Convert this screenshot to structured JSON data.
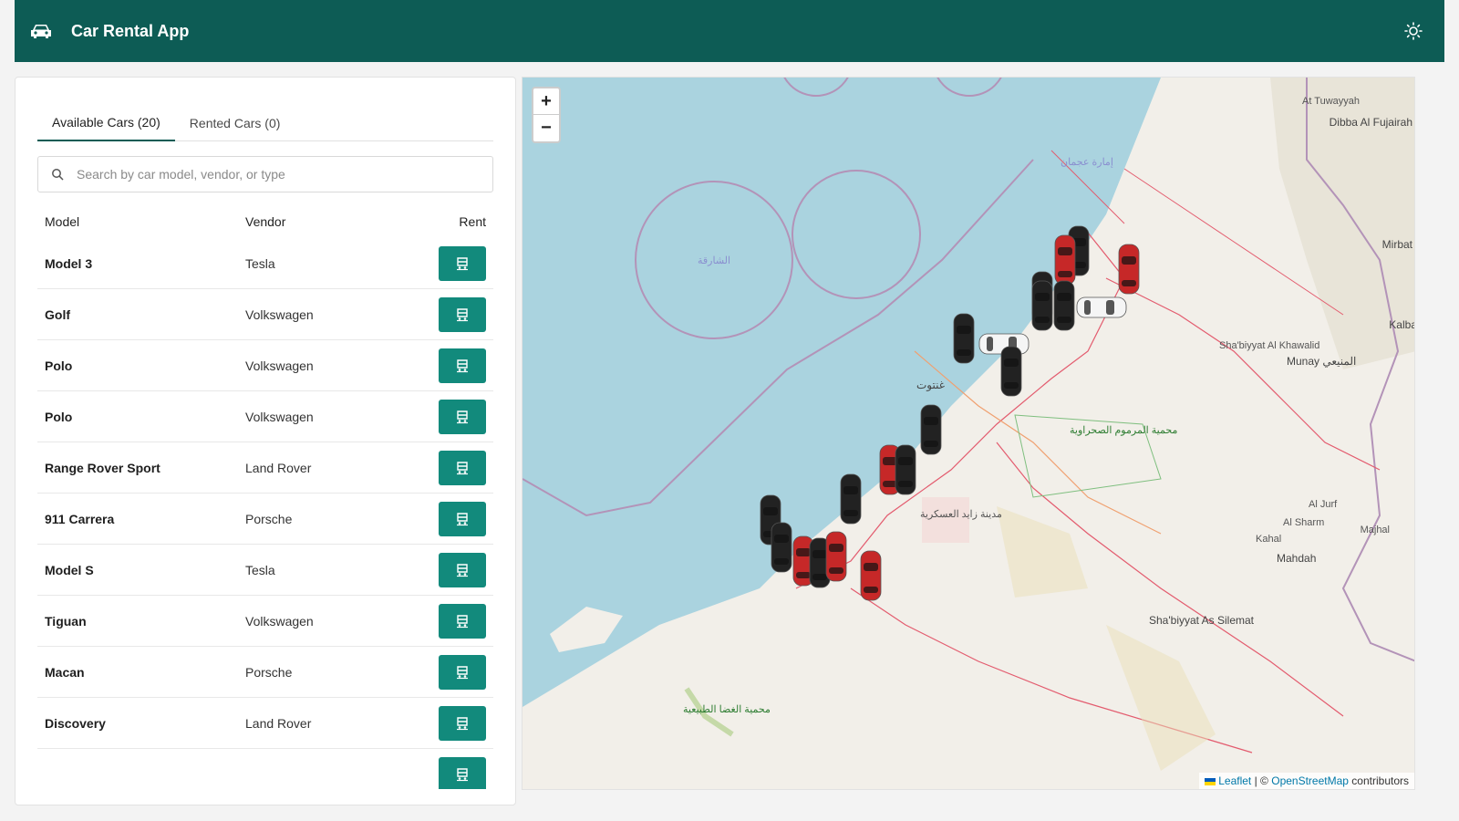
{
  "app": {
    "title": "Car Rental App",
    "accent": "#0d5c55",
    "button_color": "#128a7c"
  },
  "tabs": [
    {
      "label": "Available Cars (20)",
      "active": true
    },
    {
      "label": "Rented Cars (0)",
      "active": false
    }
  ],
  "search": {
    "placeholder": "Search by car model, vendor, or type",
    "value": ""
  },
  "table": {
    "headers": {
      "model": "Model",
      "vendor": "Vendor",
      "rent": "Rent"
    },
    "rows": [
      {
        "model": "Model 3",
        "vendor": "Tesla"
      },
      {
        "model": "Golf",
        "vendor": "Volkswagen"
      },
      {
        "model": "Polo",
        "vendor": "Volkswagen"
      },
      {
        "model": "Polo",
        "vendor": "Volkswagen"
      },
      {
        "model": "Range Rover Sport",
        "vendor": "Land Rover"
      },
      {
        "model": "911 Carrera",
        "vendor": "Porsche"
      },
      {
        "model": "Model S",
        "vendor": "Tesla"
      },
      {
        "model": "Tiguan",
        "vendor": "Volkswagen"
      },
      {
        "model": "Macan",
        "vendor": "Porsche"
      },
      {
        "model": "Discovery",
        "vendor": "Land Rover"
      },
      {
        "model": "",
        "vendor": ""
      }
    ]
  },
  "map": {
    "zoom_in": "+",
    "zoom_out": "−",
    "attribution": {
      "leaflet": "Leaflet",
      "sep": "| ©",
      "osm": "OpenStreetMap",
      "suffix": "contributors"
    },
    "labels": [
      {
        "text": "الشارقة",
        "cls": "blue"
      },
      {
        "text": "Sha'biyyat As Silemat",
        "cls": "big"
      },
      {
        "text": "Mahdah",
        "cls": "big"
      },
      {
        "text": "Munay المنيعي",
        "cls": "big"
      },
      {
        "text": "Dibba Al Fujairah",
        "cls": "big"
      },
      {
        "text": "Kalba",
        "cls": "big"
      },
      {
        "text": "Mirbat",
        "cls": "big"
      },
      {
        "text": "محمية المرموم الصحراوية",
        "cls": "green"
      },
      {
        "text": "محمية الغضا الطبيعية",
        "cls": "green"
      },
      {
        "text": "مدينة زايد العسكرية",
        "cls": ""
      },
      {
        "text": "غنتوت",
        "cls": "big"
      },
      {
        "text": "إمارة عجمان",
        "cls": "blue"
      },
      {
        "text": "At Tuwayyah",
        "cls": ""
      },
      {
        "text": "Sha'biyyat Al Khawalid",
        "cls": ""
      },
      {
        "text": "Al Jurf",
        "cls": ""
      },
      {
        "text": "Kahal",
        "cls": ""
      },
      {
        "text": "Al Sharm",
        "cls": ""
      },
      {
        "text": "Majhal",
        "cls": ""
      }
    ],
    "cars": [
      {
        "color": "#222222"
      },
      {
        "color": "#c62828"
      },
      {
        "color": "#222222"
      },
      {
        "color": "#c62828"
      },
      {
        "color": "#222222"
      },
      {
        "color": "#222222"
      },
      {
        "color": "#f5f5f5"
      },
      {
        "color": "#222222"
      },
      {
        "color": "#f5f5f5"
      },
      {
        "color": "#222222"
      },
      {
        "color": "#222222"
      },
      {
        "color": "#c62828"
      },
      {
        "color": "#222222"
      },
      {
        "color": "#222222"
      },
      {
        "color": "#222222"
      },
      {
        "color": "#222222"
      },
      {
        "color": "#c62828"
      },
      {
        "color": "#222222"
      },
      {
        "color": "#c62828"
      },
      {
        "color": "#c62828"
      }
    ]
  }
}
